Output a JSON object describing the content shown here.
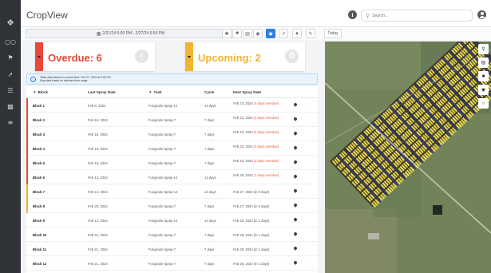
{
  "app": {
    "title": "CropView"
  },
  "search": {
    "placeholder": "Search..."
  },
  "toolbar": {
    "date_range": "2/21/24 6:00 PM - 2/27/24 6:50 PM",
    "today_label": "Today"
  },
  "cards": {
    "overdue": {
      "label": "Overdue: 6",
      "color": "#e8473a"
    },
    "upcoming": {
      "label": "Upcoming: 2",
      "color": "#f2b531"
    }
  },
  "notice": {
    "line1": "Table data based on current time: Feb 27, 2024 at 2:33 PM",
    "line2": "Map data based on selected time range"
  },
  "table": {
    "headers": {
      "block": "Block",
      "last": "Last Spray Date",
      "task": "Task",
      "cycle": "Cycle",
      "next": "Next Spray Date"
    },
    "rows": [
      {
        "block": "Block 1",
        "last": "Feb 9, 2024",
        "task": "Fungicide Spray-14",
        "cycle": "14 days",
        "next": "Feb 23, 2024",
        "overdue": "(4 days overdue)",
        "status": "overdue"
      },
      {
        "block": "Block 2",
        "last": "Feb 16, 2024",
        "task": "Fungicide Spray-7",
        "cycle": "7 days",
        "next": "Feb 23, 2024",
        "overdue": "(4 days overdue)",
        "status": "overdue"
      },
      {
        "block": "Block 3",
        "last": "Feb 16, 2024",
        "task": "Fungicide Spray-7",
        "cycle": "7 days",
        "next": "Feb 23, 2024",
        "overdue": "(4 days overdue)",
        "status": "overdue"
      },
      {
        "block": "Block 4",
        "last": "Feb 16, 2024",
        "task": "Fungicide Spray-7",
        "cycle": "7 days",
        "next": "Feb 23, 2024",
        "overdue": "(4 days overdue)",
        "status": "overdue"
      },
      {
        "block": "Block 5",
        "last": "Feb 16, 2024",
        "task": "Fungicide Spray-7",
        "cycle": "7 days",
        "next": "Feb 23, 2024",
        "overdue": "(4 days overdue)",
        "status": "overdue"
      },
      {
        "block": "Block 6",
        "last": "Feb 12, 2024",
        "task": "Fungicide Spray-14",
        "cycle": "14 days",
        "next": "Feb 26, 2024",
        "overdue": "(1 days overdue)",
        "status": "overdue"
      },
      {
        "block": "Block 7",
        "last": "Feb 13, 2024",
        "task": "Fungicide Spray-14",
        "cycle": "14 days",
        "next": "Feb 27, 2024 (in 0 days)",
        "overdue": "",
        "status": "upcoming"
      },
      {
        "block": "Block 8",
        "last": "Feb 20, 2024",
        "task": "Fungicide Spray-7",
        "cycle": "7 days",
        "next": "Feb 27, 2024 (in 0 days)",
        "overdue": "",
        "status": "upcoming"
      },
      {
        "block": "Block 9",
        "last": "Feb 14, 2024",
        "task": "Fungicide Spray-14",
        "cycle": "14 days",
        "next": "Feb 28, 2024 (in 1 days)",
        "overdue": "",
        "status": "ok"
      },
      {
        "block": "Block 10",
        "last": "Feb 21, 2024",
        "task": "Fungicide Spray-7",
        "cycle": "7 days",
        "next": "Feb 28, 2024 (in 1 days)",
        "overdue": "",
        "status": "ok"
      },
      {
        "block": "Block 11",
        "last": "Feb 21, 2024",
        "task": "Fungicide Spray-7",
        "cycle": "7 days",
        "next": "Feb 28, 2024 (in 1 days)",
        "overdue": "",
        "status": "ok"
      },
      {
        "block": "Block 12",
        "last": "Feb 21, 2024",
        "task": "Fungicide Spray-7",
        "cycle": "7 days",
        "next": "Feb 28, 2024 (in 1 days)",
        "overdue": "",
        "status": "ok"
      }
    ]
  },
  "colors": {
    "overdue": "#e8473a",
    "upcoming": "#f2b531",
    "accent": "#2f7fe0",
    "sidebar": "#2f3237"
  },
  "icons": {
    "sidebar": [
      "logo-icon",
      "binoculars-icon",
      "tractor-icon",
      "pin-icon",
      "list-icon",
      "chart-icon",
      "settings-icon"
    ],
    "map": [
      "location-icon",
      "layers-icon",
      "comment-icon",
      "palette-icon",
      "binoculars-icon"
    ]
  }
}
